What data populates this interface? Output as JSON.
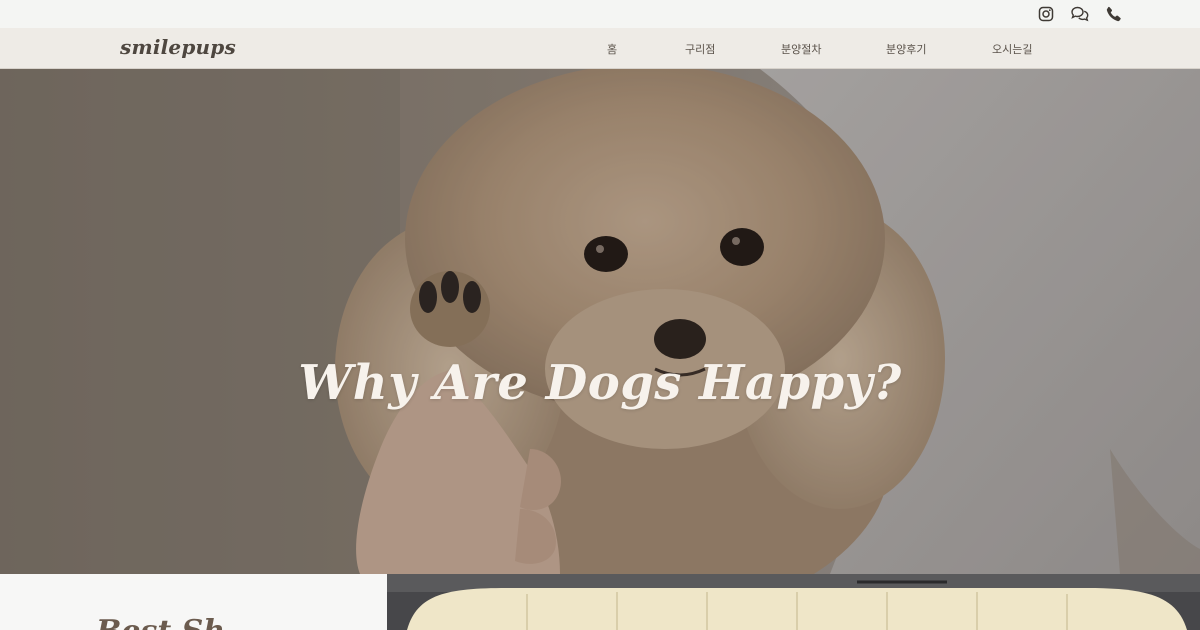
{
  "header": {
    "logo": "smilepups",
    "social_icons": [
      "instagram-icon",
      "chat-icon",
      "phone-icon"
    ]
  },
  "nav": {
    "items": [
      {
        "label": "홈"
      },
      {
        "label": "구리점"
      },
      {
        "label": "분양절차"
      },
      {
        "label": "분양후기"
      },
      {
        "label": "오시는길"
      }
    ]
  },
  "hero": {
    "title": "Why Are Dogs Happy?"
  },
  "section": {
    "heading": "Best Sh"
  },
  "colors": {
    "nav_background": "#eeebe6",
    "hero_text": "#f7f2ec",
    "logo": "#4e4740"
  }
}
